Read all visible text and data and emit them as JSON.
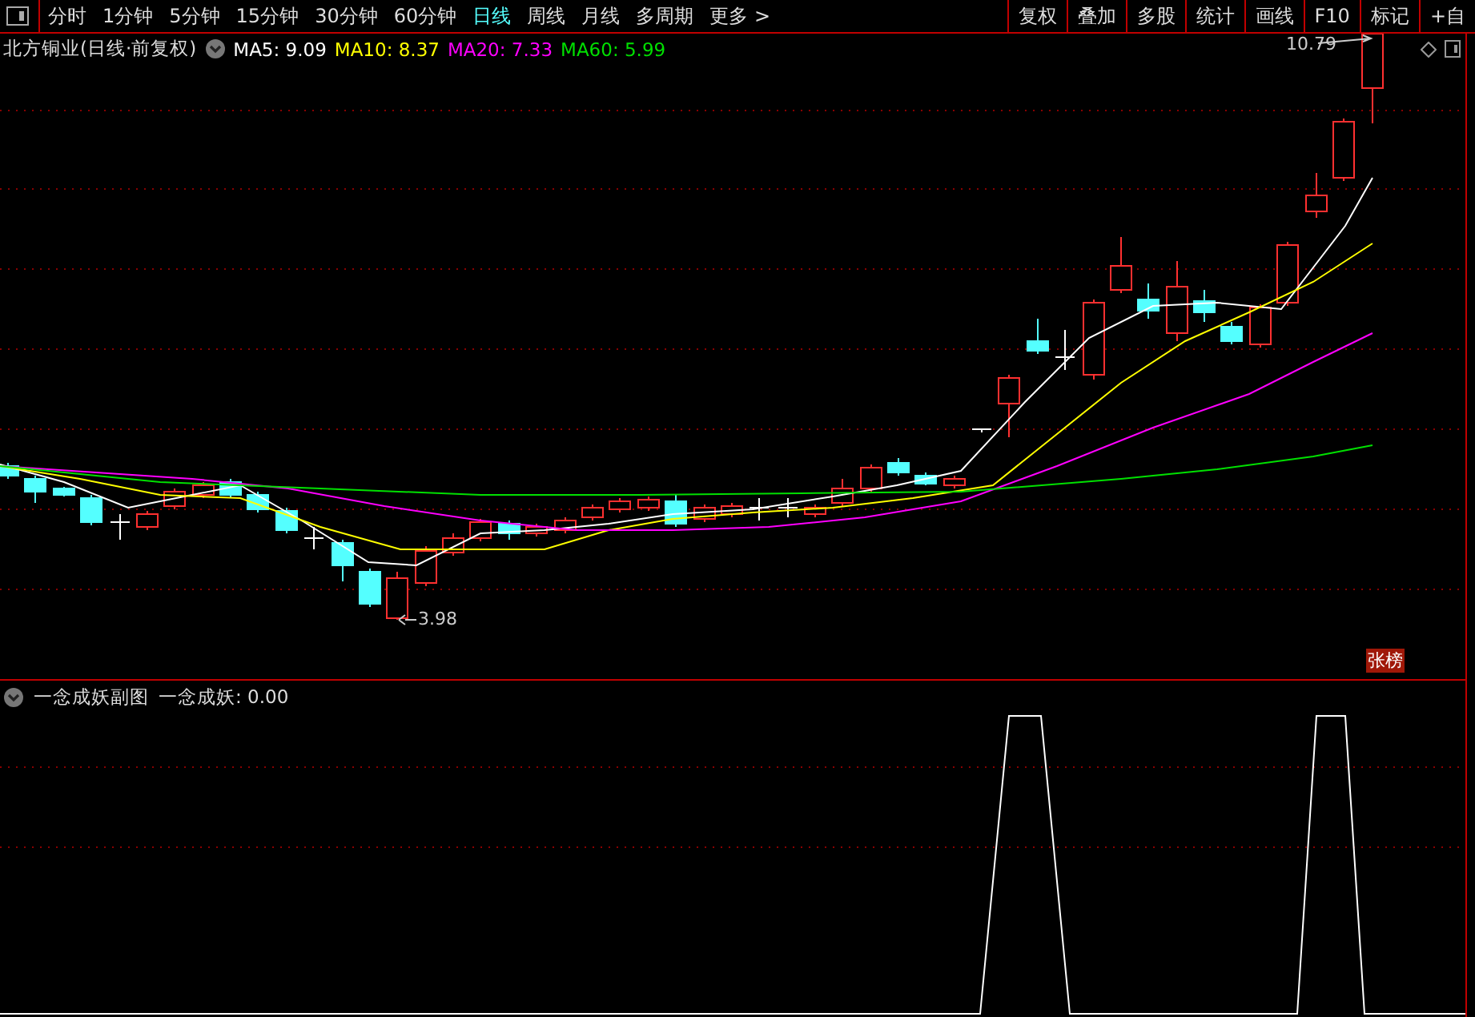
{
  "toolbar": {
    "periods": [
      {
        "label": "分时",
        "selected": false
      },
      {
        "label": "1分钟",
        "selected": false
      },
      {
        "label": "5分钟",
        "selected": false
      },
      {
        "label": "15分钟",
        "selected": false
      },
      {
        "label": "30分钟",
        "selected": false
      },
      {
        "label": "60分钟",
        "selected": false
      },
      {
        "label": "日线",
        "selected": true
      },
      {
        "label": "周线",
        "selected": false
      },
      {
        "label": "月线",
        "selected": false
      },
      {
        "label": "多周期",
        "selected": false
      },
      {
        "label": "更多 >",
        "selected": false
      }
    ],
    "tools": [
      "复权",
      "叠加",
      "多股",
      "统计",
      "画线",
      "F10",
      "标记",
      "+自"
    ]
  },
  "main_chart": {
    "title": "北方铜业(日线·前复权)",
    "indicators": [
      {
        "label": "MA5: 9.09",
        "color": "#ffffff"
      },
      {
        "label": "MA10: 8.37",
        "color": "#ffff00"
      },
      {
        "label": "MA20: 7.33",
        "color": "#ff00ff"
      },
      {
        "label": "MA60: 5.99",
        "color": "#00e000"
      }
    ],
    "high_label": "10.79",
    "low_label": "3.98",
    "badge": "张榜"
  },
  "sub_chart": {
    "title": "一念成妖副图",
    "value": "一念成妖: 0.00"
  }
}
